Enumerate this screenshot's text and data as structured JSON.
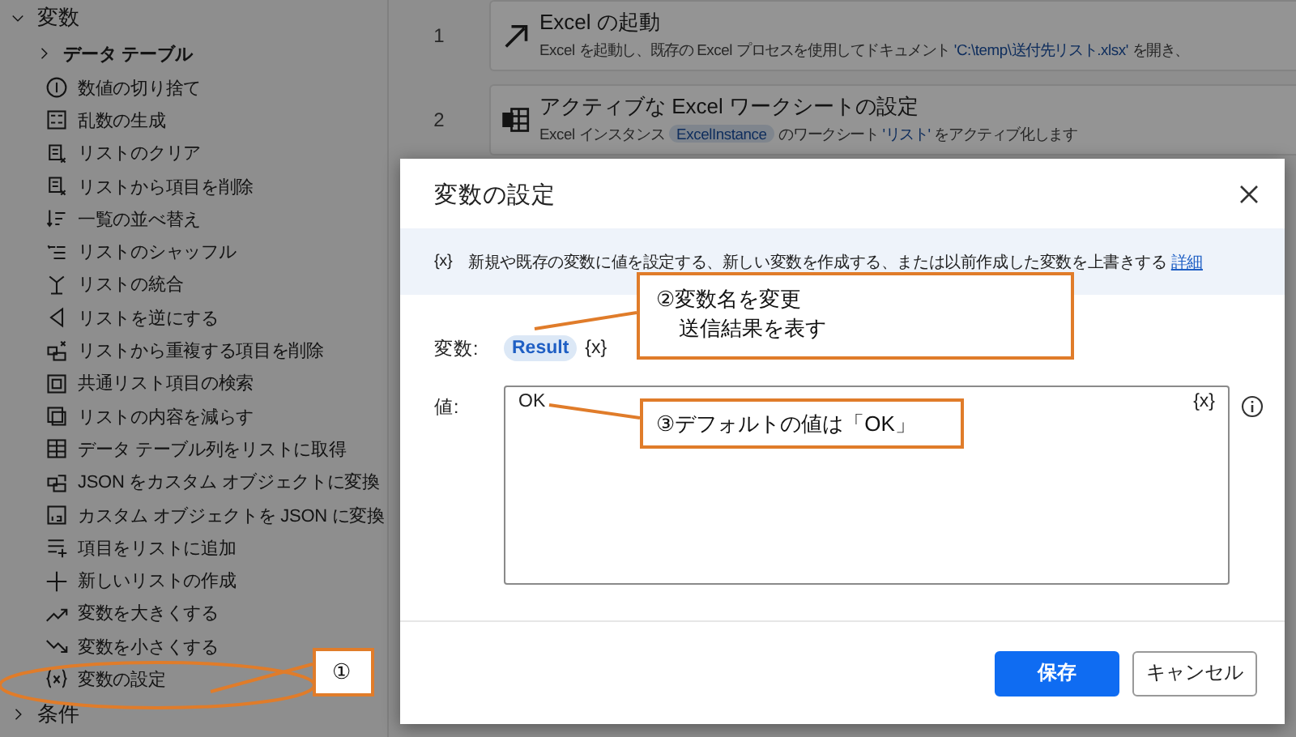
{
  "sidebar": {
    "groups": [
      {
        "label": "変数",
        "expanded": true,
        "children": [
          {
            "label": "データ テーブル",
            "expanded": false
          },
          {
            "label": "数値の切り捨て"
          },
          {
            "label": "乱数の生成"
          },
          {
            "label": "リストのクリア"
          },
          {
            "label": "リストから項目を削除"
          },
          {
            "label": "一覧の並べ替え"
          },
          {
            "label": "リストのシャッフル"
          },
          {
            "label": "リストの統合"
          },
          {
            "label": "リストを逆にする"
          },
          {
            "label": "リストから重複する項目を削除"
          },
          {
            "label": "共通リスト項目の検索"
          },
          {
            "label": "リストの内容を減らす"
          },
          {
            "label": "データ テーブル列をリストに取得"
          },
          {
            "label": "JSON をカスタム オブジェクトに変換"
          },
          {
            "label": "カスタム オブジェクトを JSON に変換"
          },
          {
            "label": "項目をリストに追加"
          },
          {
            "label": "新しいリストの作成"
          },
          {
            "label": "変数を大きくする"
          },
          {
            "label": "変数を小さくする"
          },
          {
            "label": "変数の設定"
          }
        ]
      },
      {
        "label": "条件",
        "expanded": false
      }
    ]
  },
  "flow": {
    "steps": [
      {
        "number": "1",
        "title": "Excel の起動",
        "description": [
          {
            "kind": "text",
            "text": "Excel を起動し、既存の Excel プロセスを使用してドキュメント "
          },
          {
            "kind": "literal",
            "text": "'C:\\temp\\送付先リスト.xlsx'"
          },
          {
            "kind": "text",
            "text": " を開き、"
          }
        ]
      },
      {
        "number": "2",
        "title": "アクティブな Excel ワークシートの設定",
        "description": [
          {
            "kind": "text",
            "text": "Excel インスタンス "
          },
          {
            "kind": "variable",
            "text": "ExcelInstance"
          },
          {
            "kind": "text",
            "text": " のワークシート "
          },
          {
            "kind": "literal",
            "text": "'リスト'"
          },
          {
            "kind": "text",
            "text": " をアクティブ化します"
          }
        ]
      }
    ]
  },
  "dialog": {
    "title": "変数の設定",
    "info": {
      "symbol": "{x}",
      "text": "新規や既存の変数に値を設定する、新しい変数を作成する、または以前作成した変数を上書きする",
      "link": "詳細"
    },
    "variable": {
      "label": "変数:",
      "name": "Result",
      "picker": "{x}"
    },
    "value": {
      "label": "値:",
      "value": "OK",
      "picker": "{x}"
    },
    "buttons": [
      {
        "label": "保存",
        "kind": "primary"
      },
      {
        "label": "キャンセル",
        "kind": "secondary"
      }
    ]
  },
  "annotations": [
    {
      "lines": [
        "①"
      ]
    },
    {
      "lines": [
        "②変数名を変更",
        "送信結果を表す"
      ]
    },
    {
      "lines": [
        "③デフォルトの値は「OK」"
      ]
    }
  ]
}
